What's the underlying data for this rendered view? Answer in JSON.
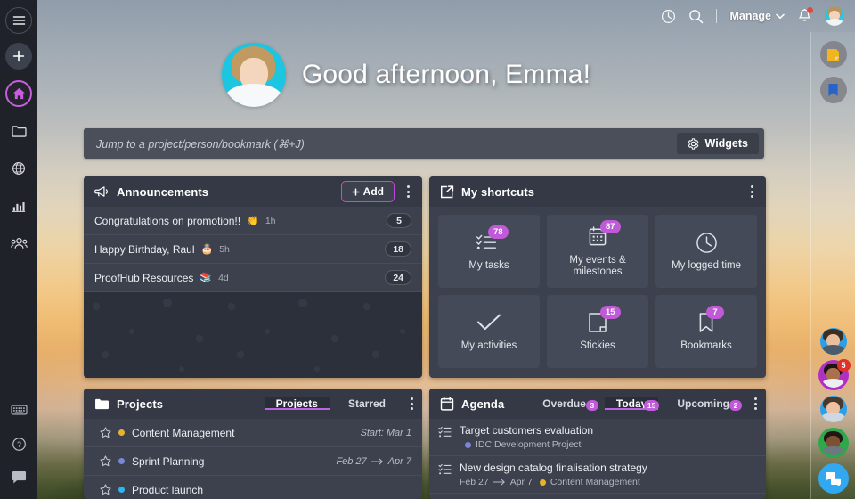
{
  "topbar": {
    "clock_icon": "clock-icon",
    "search_icon": "search-icon",
    "manage_label": "Manage",
    "chevron_icon": "chevron-down-icon",
    "bell_icon": "bell-icon",
    "avatar": "user-avatar"
  },
  "greeting": {
    "text": "Good afternoon, Emma!",
    "avatar": "emma-avatar"
  },
  "jumpbar": {
    "placeholder": "Jump to a project/person/bookmark (⌘+J)",
    "widgets_label": "Widgets",
    "widgets_icon": "gear-icon"
  },
  "left_rail": {
    "items": [
      {
        "name": "menu-icon",
        "label": "Menu"
      },
      {
        "name": "plus-icon",
        "label": "Create"
      },
      {
        "name": "home-icon",
        "label": "Home",
        "active": true
      },
      {
        "name": "folder-icon",
        "label": "Projects"
      },
      {
        "name": "globe-icon",
        "label": "Network"
      },
      {
        "name": "chart-icon",
        "label": "Reports"
      },
      {
        "name": "people-icon",
        "label": "People"
      }
    ],
    "bottom_items": [
      {
        "name": "keyboard-icon",
        "label": "Keyboard shortcuts"
      },
      {
        "name": "help-icon",
        "label": "Help"
      },
      {
        "name": "chat-icon",
        "label": "Chat"
      }
    ]
  },
  "announcements": {
    "title": "Announcements",
    "icon": "megaphone-icon",
    "add_label": "Add",
    "menu_icon": "kebab-menu-icon",
    "rows": [
      {
        "title": "Congratulations on promotion!!",
        "emoji": "👏",
        "time": "1h",
        "count": "5"
      },
      {
        "title": "Happy Birthday, Raul",
        "emoji": "🎂",
        "time": "5h",
        "count": "18"
      },
      {
        "title": "ProofHub Resources",
        "emoji": "📚",
        "time": "4d",
        "count": "24"
      }
    ]
  },
  "shortcuts": {
    "title": "My shortcuts",
    "icon": "share-box-icon",
    "menu_icon": "kebab-menu-icon",
    "tiles": [
      {
        "label": "My tasks",
        "badge": "78",
        "icon": "checklist-icon"
      },
      {
        "label": "My events & milestones",
        "badge": "87",
        "icon": "calendar-icon"
      },
      {
        "label": "My logged time",
        "badge": "",
        "icon": "clock-icon"
      },
      {
        "label": "My activities",
        "badge": "",
        "icon": "check-icon"
      },
      {
        "label": "Stickies",
        "badge": "15",
        "icon": "sticky-note-icon"
      },
      {
        "label": "Bookmarks",
        "badge": "7",
        "icon": "bookmark-icon"
      }
    ]
  },
  "projects": {
    "title": "Projects",
    "icon": "folder-icon",
    "menu_icon": "kebab-menu-icon",
    "tabs": [
      {
        "label": "Projects",
        "active": true
      },
      {
        "label": "Starred",
        "active": false
      }
    ],
    "rows": [
      {
        "name": "Content Management",
        "color": "#e8b32a",
        "date": "Start: Mar 1",
        "start": "",
        "end": "",
        "star": "star-icon"
      },
      {
        "name": "Sprint Planning",
        "color": "#7b86d8",
        "date": "",
        "start": "Feb 27",
        "end": "Apr 7",
        "star": "star-icon"
      },
      {
        "name": "Product launch",
        "color": "#2bb6ee",
        "date": "",
        "start": "",
        "end": "",
        "star": "star-icon"
      }
    ]
  },
  "agenda": {
    "title": "Agenda",
    "icon": "calendar-icon",
    "menu_icon": "kebab-menu-icon",
    "tabs": [
      {
        "label": "Overdue",
        "badge": "3",
        "active": false
      },
      {
        "label": "Today",
        "badge": "15",
        "active": true
      },
      {
        "label": "Upcoming",
        "badge": "2",
        "active": false
      }
    ],
    "rows": [
      {
        "title": "Target customers evaluation",
        "project": "IDC Development Project",
        "project_color": "#7b86d8",
        "start": "",
        "end": "",
        "icon": "task-list-icon"
      },
      {
        "title": "New design catalog finalisation strategy",
        "project": "Content Management",
        "project_color": "#e8b32a",
        "start": "Feb 27",
        "end": "Apr 7",
        "icon": "task-list-icon"
      }
    ]
  },
  "right_rail": {
    "top_buttons": [
      {
        "name": "sticky-note-icon",
        "color": "#f0b51f"
      },
      {
        "name": "bookmark-icon",
        "color": "#2763c9"
      }
    ],
    "avatars": [
      {
        "name": "user-avatar-1",
        "badge": ""
      },
      {
        "name": "user-avatar-2",
        "badge": "5"
      },
      {
        "name": "user-avatar-3",
        "badge": ""
      },
      {
        "name": "user-avatar-4",
        "badge": ""
      }
    ],
    "chat_icon": "chat-bubbles-icon"
  },
  "colors": {
    "accent": "#bb63e0",
    "badge": "#c15ad8",
    "panel": "#3c414d",
    "panel_head": "#343945",
    "danger": "#e0322b"
  }
}
